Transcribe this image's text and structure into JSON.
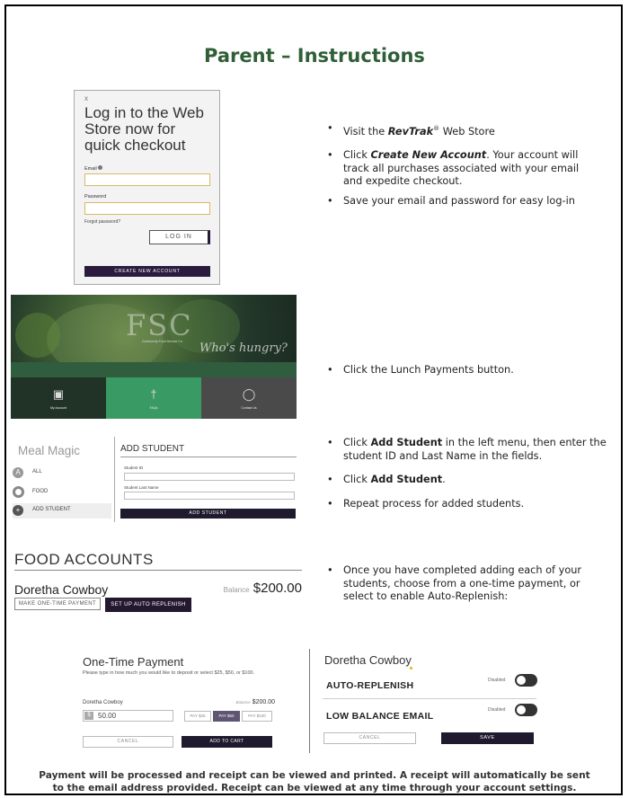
{
  "title": "Parent – Instructions",
  "bullets1": {
    "b1_pre": "Visit the ",
    "b1_brand": "RevTrak",
    "b1_reg": "®",
    "b1_post": " Web Store",
    "b2_pre": "Click ",
    "b2_em": "Create New Account",
    "b2_post": ". Your account will track all purchases associated with your email and expedite checkout.",
    "b3": "Save your email and password for easy log-in"
  },
  "bullets2": {
    "b1": "Click the Lunch Payments button."
  },
  "bullets3": {
    "b1_pre": "Click ",
    "b1_bold": "Add Student",
    "b1_post": " in the left menu, then enter the student ID and Last Name in the fields.",
    "b2_pre": "Click ",
    "b2_bold": "Add Student",
    "b2_post": ".",
    "b3": "Repeat process for added students."
  },
  "bullets4": {
    "b1": "Once you have completed adding each of your students, choose from a one-time payment, or select to enable Auto-Replenish:"
  },
  "login": {
    "close": "x",
    "heading": "Log in to the Web Store now for quick checkout",
    "email_label": "Email",
    "password_label": "Password",
    "forgot": "Forgot password?",
    "login_button": "LOG IN",
    "create_button": "CREATE NEW ACCOUNT"
  },
  "banner": {
    "logo": "FSC",
    "tagline": "Community Food Service Co.",
    "hungry": "Who's hungry?",
    "tiles": [
      "My Account",
      "FAQs",
      "Contact Us"
    ],
    "tile_colors": [
      "#213327",
      "#3a9a63",
      "#4a4a4a"
    ]
  },
  "meal": {
    "brand": "Meal Magic",
    "menu": [
      {
        "icon": "A",
        "label": "ALL"
      },
      {
        "icon": "",
        "label": "FOOD"
      },
      {
        "icon": "+",
        "label": "ADD STUDENT"
      }
    ],
    "form_title": "ADD STUDENT",
    "student_id_label": "Student ID",
    "last_name_label": "Student Last Name",
    "add_button": "ADD STUDENT"
  },
  "food": {
    "heading": "FOOD ACCOUNTS",
    "student": "Doretha Cowboy",
    "balance_label": "Balance",
    "balance": "$200.00",
    "one_time_button": "MAKE ONE-TIME PAYMENT",
    "auto_button": "SET UP AUTO REPLENISH"
  },
  "otp": {
    "heading": "One-Time Payment",
    "desc": "Please type in how much you would like to deposit or select $25, $50, or $100.",
    "student": "Doretha Cowboy",
    "balance_label": "Balance",
    "balance": "$200.00",
    "currency": "$",
    "amount": "50.00",
    "pay_buttons": [
      "PAY $25",
      "PAY $50",
      "PAY $100"
    ],
    "selected": "PAY $50",
    "cancel": "CANCEL",
    "cart": "ADD TO CART"
  },
  "auto": {
    "student": "Doretha Cowboy",
    "auto_label": "AUTO-REPLENISH",
    "low_label": "LOW BALANCE EMAIL",
    "disabled": "Disabled",
    "cancel": "CANCEL",
    "save": "SAVE"
  },
  "footer": "Payment will be processed and receipt can be viewed and printed.  A receipt will automatically be sent to the email address provided. Receipt can be viewed at any time through your account settings."
}
